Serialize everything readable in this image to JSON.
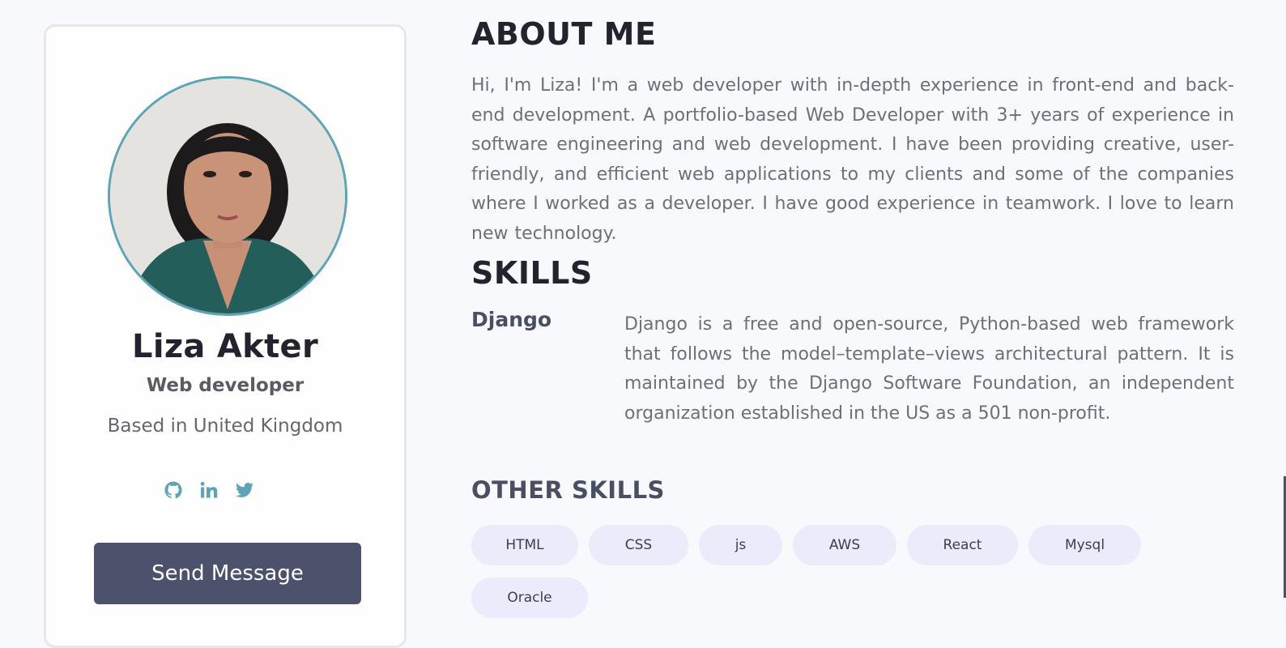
{
  "profile": {
    "name": "Liza Akter",
    "role": "Web developer",
    "location": "Based in United Kingdom",
    "socials": [
      {
        "icon": "github-icon"
      },
      {
        "icon": "linkedin-icon"
      },
      {
        "icon": "twitter-icon"
      }
    ],
    "send_label": "Send Message"
  },
  "about": {
    "title": "ABOUT ME",
    "text": "Hi, I'm Liza! I'm a web developer with in-depth experience in front-end and back-end development. A portfolio-based Web Developer with 3+ years of experience in software engineering and web development. I have been providing creative, user-friendly, and efficient web applications to my clients and some of the companies where I worked as a developer. I have good experience in teamwork. I love to learn new technology."
  },
  "skills": {
    "title": "SKILLS",
    "items": [
      {
        "name": "Django",
        "description": "Django is a free and open-source, Python-based web framework that follows the model–template–views architectural pattern. It is maintained by the Django Software Foundation, an independent organization established in the US as a 501 non-profit."
      }
    ]
  },
  "other_skills": {
    "title": "OTHER SKILLS",
    "tags": [
      "HTML",
      "CSS",
      "js",
      "AWS",
      "React",
      "Mysql",
      "Oracle"
    ]
  },
  "colors": {
    "accent": "#5fa3b6",
    "button": "#4d526c",
    "tag_bg": "#ecebfb",
    "background": "#f8f9fd"
  }
}
